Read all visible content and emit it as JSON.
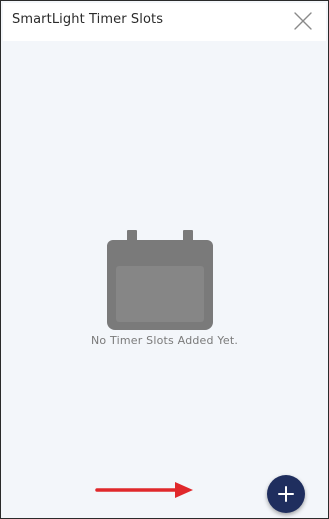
{
  "header": {
    "title": "SmartLight Timer Slots",
    "close_icon": "close-icon"
  },
  "empty_state": {
    "icon": "calendar-icon",
    "message": "No Timer Slots Added Yet."
  },
  "fab": {
    "icon": "plus-icon"
  },
  "annotation": {
    "icon": "arrow-right-icon"
  },
  "colors": {
    "background": "#f3f6fa",
    "header_background": "#ffffff",
    "icon_gray": "#7a7a7a",
    "fab_navy": "#1f2e5e",
    "annotation_red": "#e0282b"
  }
}
